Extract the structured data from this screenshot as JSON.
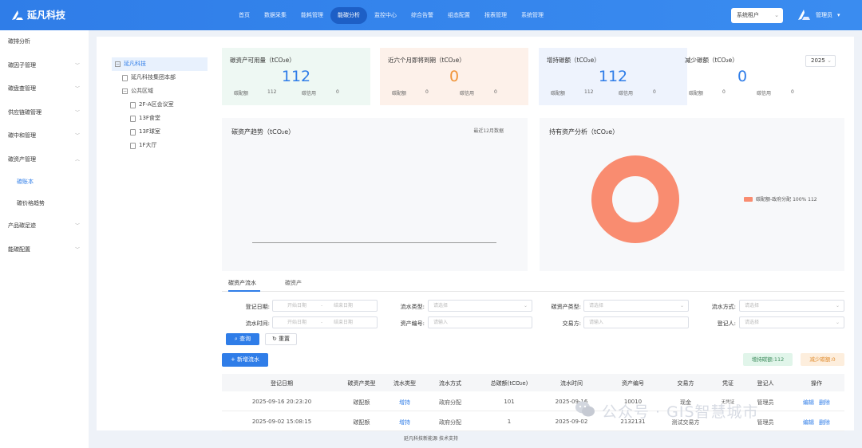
{
  "app": {
    "logo_text": "延凡科技"
  },
  "topnav": [
    {
      "label": "首页"
    },
    {
      "label": "数据采集"
    },
    {
      "label": "能耗管理"
    },
    {
      "label": "能碳分析",
      "active": true
    },
    {
      "label": "监控中心"
    },
    {
      "label": "综合告警"
    },
    {
      "label": "组态配置"
    },
    {
      "label": "报表管理"
    },
    {
      "label": "系统管理"
    }
  ],
  "tenant": {
    "label": "系统租户"
  },
  "user": {
    "name": "管理员"
  },
  "sidebar": {
    "items": [
      {
        "label": "碳排分析",
        "chevron": false
      },
      {
        "label": "碳因子管理",
        "chevron": true
      },
      {
        "label": "碳盘查管理",
        "chevron": true
      },
      {
        "label": "供应链碳管理",
        "chevron": true
      },
      {
        "label": "碳中和管理",
        "chevron": true
      },
      {
        "label": "碳资产管理",
        "chevron": true,
        "expanded": true
      }
    ],
    "subitems": [
      {
        "label": "碳账本",
        "active": true
      },
      {
        "label": "碳价格趋势"
      }
    ],
    "items2": [
      {
        "label": "产品碳足迹",
        "chevron": true
      },
      {
        "label": "能碳配置",
        "chevron": true
      }
    ]
  },
  "tree": {
    "root": "延凡科技",
    "nodes": [
      {
        "label": "延凡科技集团本部",
        "indent": 1,
        "type": "doc"
      },
      {
        "label": "公共区域",
        "indent": 1,
        "type": "folder"
      },
      {
        "label": "2F-A区会议室",
        "indent": 2,
        "type": "doc"
      },
      {
        "label": "13F食堂",
        "indent": 2,
        "type": "doc"
      },
      {
        "label": "13F球室",
        "indent": 2,
        "type": "doc"
      },
      {
        "label": "1F大厅",
        "indent": 2,
        "type": "doc"
      }
    ]
  },
  "cards": [
    {
      "title": "碳资产可用量（tCO₂e）",
      "value": "112",
      "l1": "碳配额",
      "v1": "112",
      "l2": "碳信用",
      "v2": "0"
    },
    {
      "title": "近六个月即将到期（tCO₂e）",
      "value": "0",
      "l1": "碳配额",
      "v1": "0",
      "l2": "碳信用",
      "v2": "0"
    },
    {
      "title": "增持碳额（tCO₂e）",
      "value": "112",
      "l1": "碳配额",
      "v1": "112",
      "l2": "碳信用",
      "v2": "0"
    },
    {
      "title": "减少碳额（tCO₂e）",
      "value": "0",
      "l1": "碳配额",
      "v1": "0",
      "l2": "碳信用",
      "v2": "0"
    }
  ],
  "year_select": "2025",
  "colors": {
    "primary": "#2f7de8",
    "orange": "#f0953a",
    "pie": "#f98c70"
  },
  "trend_panel": {
    "title": "碳资产趋势（tCO₂e）",
    "hint": "最近12月数据"
  },
  "chart_data": {
    "type": "pie",
    "title": "持有资产分析（tCO₂e）",
    "slices": [
      {
        "label": "碳配额-政府分配",
        "percent": 100,
        "value": 112
      }
    ],
    "legend": {
      "text": "碳配额-政府分配 100% 112",
      "position": "right"
    }
  },
  "tabs": [
    {
      "label": "碳资产流水",
      "active": true
    },
    {
      "label": "碳资产"
    }
  ],
  "filters": {
    "reg_date": "登记日期:",
    "flow_time": "流水时间:",
    "start_placeholder": "开始日期",
    "end_placeholder": "结束日期",
    "flow_type": "流水类型:",
    "asset_no": "资产编号:",
    "asset_type": "碳资产类型:",
    "trader": "交易方:",
    "flow_way": "流水方式:",
    "registrant": "登记人:",
    "select_placeholder": "请选择",
    "input_placeholder": "请输入"
  },
  "buttons": {
    "query": "查询",
    "reset": "重置",
    "add": "新增流水"
  },
  "badges": {
    "increase": "增持碳额:112",
    "decrease": "减少碳额:0"
  },
  "table": {
    "headers": [
      "登记日期",
      "碳资产类型",
      "流水类型",
      "流水方式",
      "总碳额(tCO₂e)",
      "流水时间",
      "资产编号",
      "交易方",
      "凭证",
      "登记人",
      "操作"
    ],
    "rows": [
      [
        "2025-09-16 20:23:20",
        "碳配额",
        "增持",
        "政府分配",
        "101",
        "2025-09-16",
        "10010",
        "现金",
        "无凭证",
        "管理员"
      ],
      [
        "2025-09-02 15:08:15",
        "碳配额",
        "增持",
        "政府分配",
        "1",
        "2025-09-02",
        "2132131",
        "测试交易方",
        "",
        "管理员"
      ]
    ],
    "actions": {
      "edit": "编辑",
      "delete": "删除"
    }
  },
  "footer": "延凡科技新能源 技术支持",
  "watermark": "公众号 · GIS智慧城市"
}
